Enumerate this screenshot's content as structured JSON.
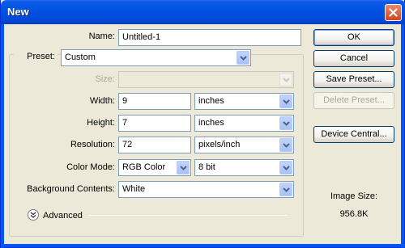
{
  "window": {
    "title": "New"
  },
  "fields": {
    "name_label": "Name:",
    "name_value": "Untitled-1",
    "preset_label": "Preset:",
    "preset_value": "Custom",
    "size_label": "Size:",
    "size_value": "",
    "width_label": "Width:",
    "width_value": "9",
    "width_unit": "inches",
    "height_label": "Height:",
    "height_value": "7",
    "height_unit": "inches",
    "resolution_label": "Resolution:",
    "resolution_value": "72",
    "resolution_unit": "pixels/inch",
    "color_mode_label": "Color Mode:",
    "color_mode_value": "RGB Color",
    "bit_depth_value": "8 bit",
    "background_label": "Background Contents:",
    "background_value": "White",
    "advanced_label": "Advanced"
  },
  "buttons": {
    "ok": "OK",
    "cancel": "Cancel",
    "save_preset": "Save Preset...",
    "delete_preset": "Delete Preset...",
    "device_central": "Device Central..."
  },
  "info": {
    "image_size_label": "Image Size:",
    "image_size_value": "956.8K"
  },
  "icons": {
    "close": "close-icon",
    "dropdown": "chevron-down-icon",
    "advanced": "double-chevron-down-icon"
  },
  "colors": {
    "titlebar": "#0054e3",
    "dialog_bg": "#ece9d8",
    "input_border": "#7f9db9",
    "button_border": "#003c74"
  }
}
